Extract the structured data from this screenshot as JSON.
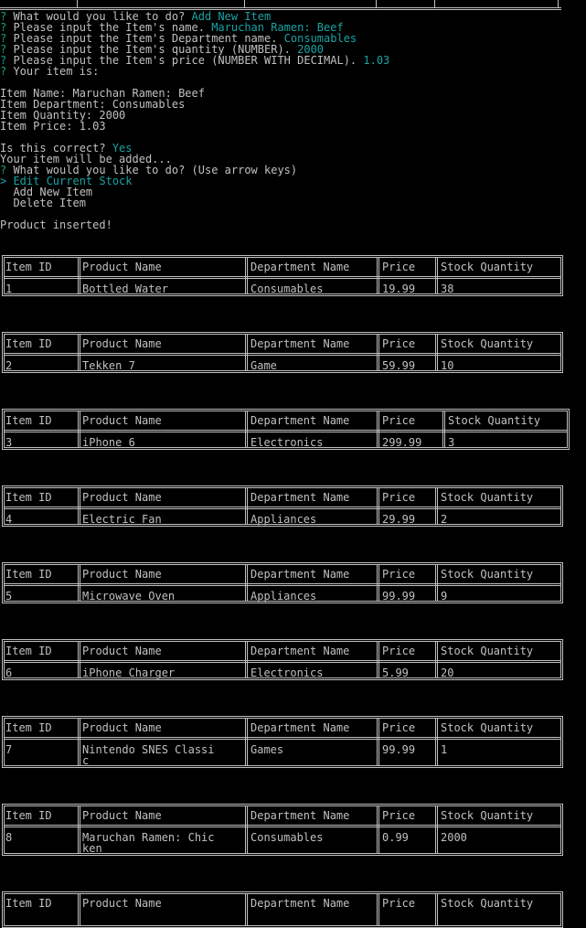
{
  "prompt_lines": [
    {
      "q": "?",
      "text": " What would you like to do? ",
      "answer": "Add New Item"
    },
    {
      "q": "?",
      "text": " Please input the Item's name. ",
      "answer": "Maruchan Ramen: Beef"
    },
    {
      "q": "?",
      "text": " Please input the Item's Department name. ",
      "answer": "Consumables"
    },
    {
      "q": "?",
      "text": " Please input the Item's quantity (NUMBER). ",
      "answer": "2000"
    },
    {
      "q": "?",
      "text": " Please input the Item's price (NUMBER WITH DECIMAL). ",
      "answer": "1.03"
    },
    {
      "q": "?",
      "text": " Your item is:",
      "answer": ""
    }
  ],
  "item_summary": [
    "Item Name: Maruchan Ramen: Beef",
    "Item Department: Consumables",
    "Item Quantity: 2000",
    "Item Price: 1.03"
  ],
  "confirm": {
    "q": "",
    "text": "Is this correct? ",
    "answer": "Yes"
  },
  "adding_text": "Your item will be added...",
  "menu": {
    "q": "?",
    "text": " What would you like to do? (Use arrow keys)",
    "pointer": ">",
    "options": [
      "Edit Current Stock",
      "Add New Item",
      "Delete Item"
    ],
    "selected_index": 0
  },
  "result_text": "Product inserted!",
  "table_headers": [
    "Item ID",
    "Product Name",
    "Department Name",
    "Price",
    "Stock Quantity"
  ],
  "rows": [
    {
      "id": "1",
      "name": [
        "Bottled Water"
      ],
      "dept": "Consumables",
      "price": "19.99",
      "qty": "38"
    },
    {
      "id": "2",
      "name": [
        "Tekken 7"
      ],
      "dept": "Game",
      "price": "59.99",
      "qty": "10"
    },
    {
      "id": "3",
      "name": [
        "iPhone 6"
      ],
      "dept": "Electronics",
      "price": "299.99",
      "qty": "3"
    },
    {
      "id": "4",
      "name": [
        "Electric Fan"
      ],
      "dept": "Appliances",
      "price": "29.99",
      "qty": "2"
    },
    {
      "id": "5",
      "name": [
        "Microwave Oven"
      ],
      "dept": "Appliances",
      "price": "99.99",
      "qty": "9"
    },
    {
      "id": "6",
      "name": [
        "iPhone Charger"
      ],
      "dept": "Electronics",
      "price": "5.99",
      "qty": "20"
    },
    {
      "id": "7",
      "name": [
        "Nintendo SNES Classi",
        "c"
      ],
      "dept": "Games",
      "price": "99.99",
      "qty": "1"
    },
    {
      "id": "8",
      "name": [
        "Maruchan Ramen: Chic",
        "ken"
      ],
      "dept": "Consumables",
      "price": "0.99",
      "qty": "2000"
    },
    {
      "id": "",
      "name": [],
      "dept": "",
      "price": "",
      "qty": ""
    }
  ]
}
